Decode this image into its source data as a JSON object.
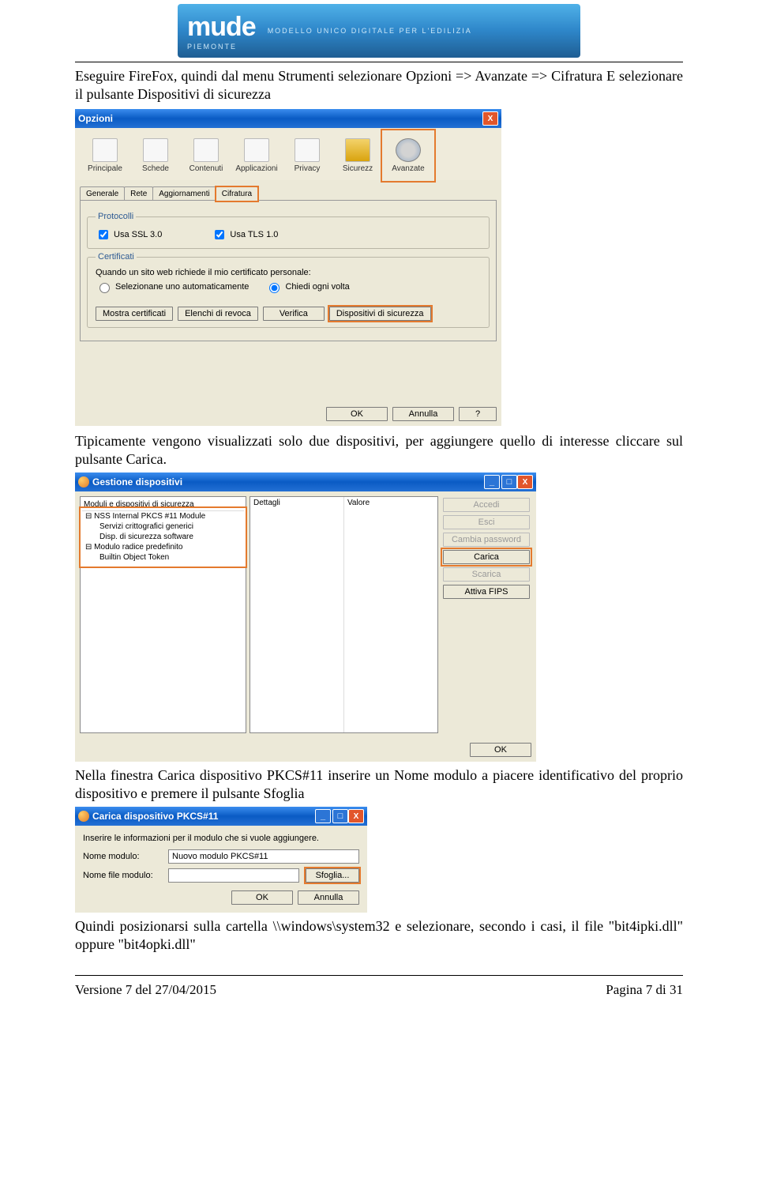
{
  "logo": {
    "brand": "mude",
    "sub1": "PIEMONTE",
    "sub2": "MODELLO UNICO DIGITALE PER L'EDILIZIA"
  },
  "intro1": "Eseguire FireFox, quindi dal menu Strumenti selezionare Opzioni => Avanzate => Cifratura E selezionare il pulsante Dispositivi di sicurezza",
  "opz": {
    "title": "Opzioni",
    "toolbar": [
      "Principale",
      "Schede",
      "Contenuti",
      "Applicazioni",
      "Privacy",
      "Sicurezz",
      "Avanzate"
    ],
    "tabs": [
      "Generale",
      "Rete",
      "Aggiornamenti",
      "Cifratura"
    ],
    "fs1": "Protocolli",
    "ssl": "Usa SSL 3.0",
    "tls": "Usa TLS 1.0",
    "fs2": "Certificati",
    "certline": "Quando un sito web richiede il mio certificato personale:",
    "r1": "Selezionane uno automaticamente",
    "r2": "Chiedi ogni volta",
    "b1": "Mostra certificati",
    "b2": "Elenchi di revoca",
    "b3": "Verifica",
    "b4": "Dispositivi di sicurezza",
    "ok": "OK",
    "cancel": "Annulla",
    "help": "?"
  },
  "para2": "Tipicamente vengono visualizzati solo due dispositivi, per aggiungere quello di interesse cliccare sul pulsante Carica.",
  "dev": {
    "title": "Gestione dispositivi",
    "colA": "Moduli e dispositivi di sicurezza",
    "colB": "Dettagli",
    "colC": "Valore",
    "n1": "NSS Internal PKCS #11 Module",
    "n1a": "Servizi crittografici generici",
    "n1b": "Disp. di sicurezza software",
    "n2": "Modulo radice predefinito",
    "n2a": "Builtin Object Token",
    "btns": {
      "accedi": "Accedi",
      "esci": "Esci",
      "cambia": "Cambia password",
      "carica": "Carica",
      "scarica": "Scarica",
      "fips": "Attiva FIPS"
    },
    "ok": "OK"
  },
  "para3": "Nella finestra Carica dispositivo PKCS#11 inserire un Nome modulo a piacere identificativo del proprio dispositivo e premere il pulsante Sfoglia",
  "pk": {
    "title": "Carica dispositivo PKCS#11",
    "instr": "Inserire le informazioni per il modulo che si vuole aggiungere.",
    "l1": "Nome modulo:",
    "v1": "Nuovo modulo PKCS#11",
    "l2": "Nome file modulo:",
    "v2": "",
    "sfoglia": "Sfoglia...",
    "ok": "OK",
    "cancel": "Annulla"
  },
  "para4": "Quindi posizionarsi sulla cartella \\\\windows\\system32 e selezionare, secondo i casi, il file \"bit4ipki.dll\" oppure \"bit4opki.dll\"",
  "footer": {
    "left": "Versione 7 del 27/04/2015",
    "right": "Pagina 7 di 31"
  }
}
